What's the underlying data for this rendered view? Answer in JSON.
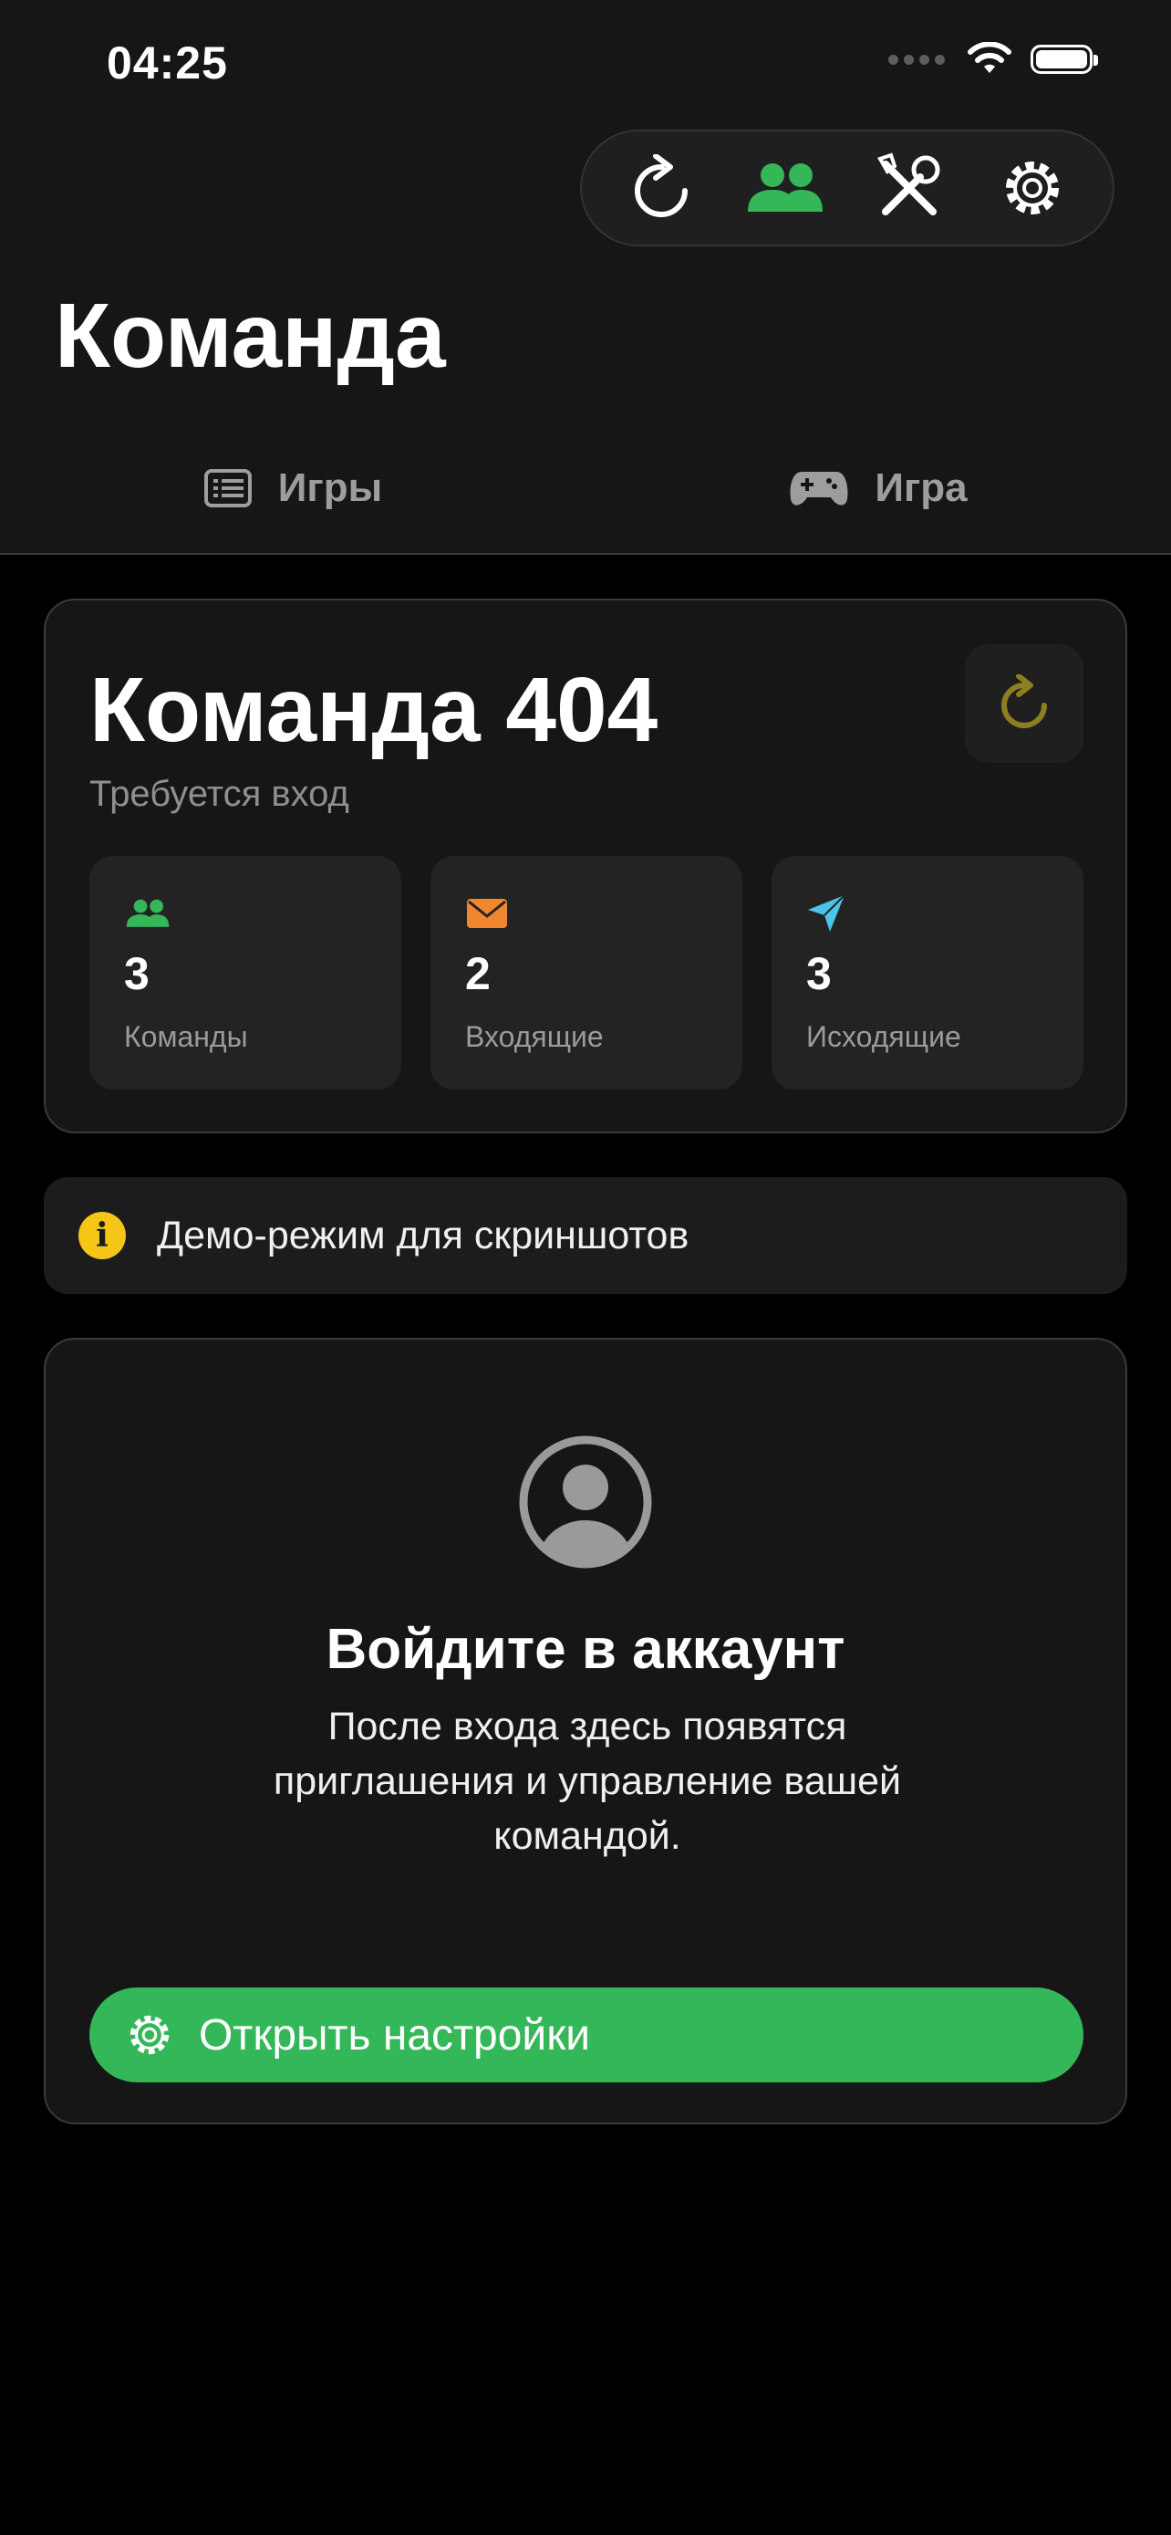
{
  "status_bar": {
    "time": "04:25"
  },
  "toolbar": {
    "buttons": [
      {
        "icon": "refresh-icon"
      },
      {
        "icon": "people-icon",
        "active": true
      },
      {
        "icon": "tools-icon"
      },
      {
        "icon": "gear-icon"
      }
    ]
  },
  "header": {
    "title": "Команда"
  },
  "tabs": [
    {
      "label": "Игры",
      "icon": "list-icon"
    },
    {
      "label": "Игра",
      "icon": "gamepad-icon"
    }
  ],
  "team": {
    "name": "Команда 404",
    "status": "Требуется вход",
    "stats": [
      {
        "icon": "people-icon",
        "value": "3",
        "label": "Команды",
        "color": "#34b758"
      },
      {
        "icon": "envelope-icon",
        "value": "2",
        "label": "Входящие",
        "color": "#f0872e"
      },
      {
        "icon": "paperplane-icon",
        "value": "3",
        "label": "Исходящие",
        "color": "#4cc3e8"
      }
    ]
  },
  "banner": {
    "icon": "info-icon",
    "text": "Демо-режим для скриншотов"
  },
  "login": {
    "title": "Войдите в аккаунт",
    "description": "После входа здесь появятся приглашения и управление вашей командой.",
    "button_label": "Открыть настройки"
  },
  "colors": {
    "accent_green": "#34b758",
    "refresh_olive": "#8c7f1f",
    "info_yellow": "#f5c518",
    "background": "#000000",
    "card": "#161616"
  }
}
